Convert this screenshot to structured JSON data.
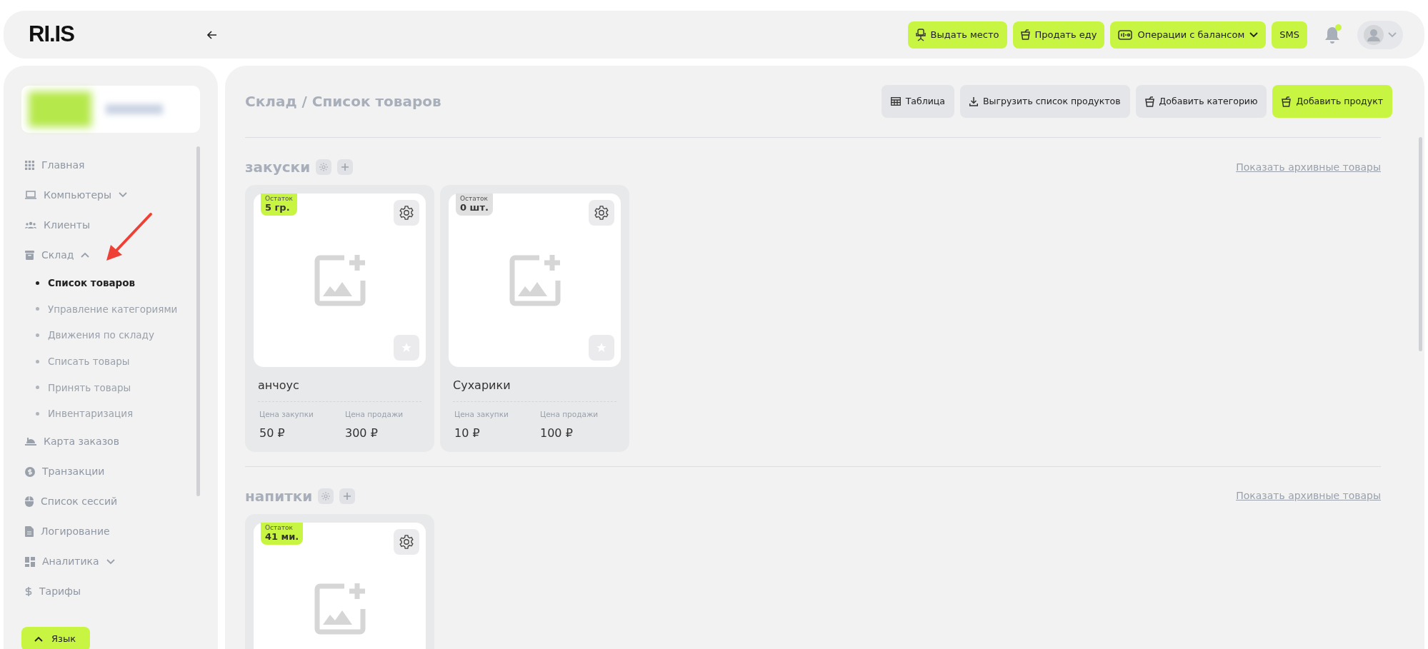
{
  "header": {
    "logo": "RI.IS",
    "buttons": [
      {
        "label": "Выдать место",
        "dropdown": false
      },
      {
        "label": "Продать еду",
        "dropdown": false
      },
      {
        "label": "Операции с балансом",
        "dropdown": true
      },
      {
        "label": "SMS",
        "dropdown": false
      }
    ],
    "notifications": {
      "unread": true
    }
  },
  "sidebar": {
    "items": [
      {
        "label": "Главная"
      },
      {
        "label": "Компьютеры",
        "expanded": false
      },
      {
        "label": "Клиенты"
      },
      {
        "label": "Склад",
        "expanded": true,
        "children": [
          {
            "label": "Список товаров",
            "selected": true
          },
          {
            "label": "Управление категориями",
            "selected": false
          },
          {
            "label": "Движения по складу",
            "selected": false
          },
          {
            "label": "Списать товары",
            "selected": false
          },
          {
            "label": "Принять товары",
            "selected": false
          },
          {
            "label": "Инвентаризация",
            "selected": false
          }
        ]
      },
      {
        "label": "Карта заказов"
      },
      {
        "label": "Транзакции"
      },
      {
        "label": "Список сессий"
      },
      {
        "label": "Логирование"
      },
      {
        "label": "Аналитика",
        "expanded": false
      },
      {
        "label": "Тарифы"
      }
    ],
    "language_button": "Язык"
  },
  "page": {
    "breadcrumb": "Склад / Список товаров",
    "actions": [
      {
        "label": "Таблица",
        "primary": false
      },
      {
        "label": "Выгрузить список продуктов",
        "primary": false
      },
      {
        "label": "Добавить категорию",
        "primary": false
      },
      {
        "label": "Добавить продукт",
        "primary": true
      }
    ],
    "categories": [
      {
        "name": "закуски",
        "archive_link": "Показать архивные товары",
        "products": [
          {
            "stock_label": "Остаток",
            "stock": "5 гр.",
            "in_stock": true,
            "name": "анчоус",
            "purchase_label": "Цена закупки",
            "purchase": "50 ₽",
            "sale_label": "Цена продажи",
            "sale": "300 ₽"
          },
          {
            "stock_label": "Остаток",
            "stock": "0 шт.",
            "in_stock": false,
            "name": "Сухарики",
            "purchase_label": "Цена закупки",
            "purchase": "10 ₽",
            "sale_label": "Цена продажи",
            "sale": "100 ₽"
          }
        ]
      },
      {
        "name": "напитки",
        "archive_link": "Показать архивные товары",
        "products": [
          {
            "stock_label": "Остаток",
            "stock": "41 ми.",
            "in_stock": true
          }
        ]
      }
    ]
  }
}
